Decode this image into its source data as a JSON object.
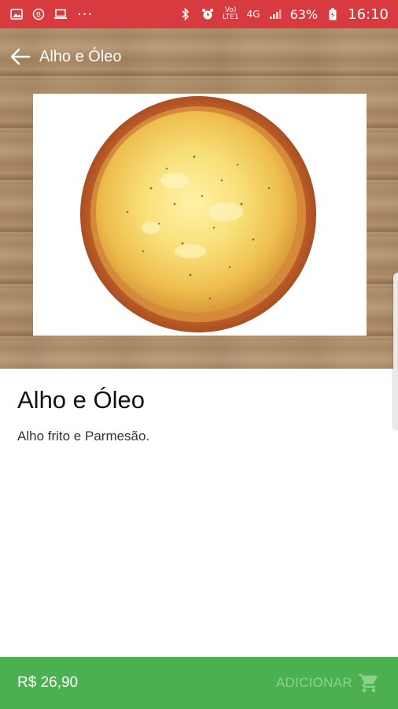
{
  "status_bar": {
    "left_icons": [
      "image-icon",
      "b-circle-icon",
      "laptop-icon"
    ],
    "more": "···",
    "network_top": "Vo)",
    "network_bottom": "LTE1",
    "net_type": "4G",
    "battery_percent": "63%",
    "time": "16:10"
  },
  "toolbar": {
    "title": "Alho e Óleo",
    "back_icon": "arrow-left-icon"
  },
  "product": {
    "name": "Alho e Óleo",
    "description": "Alho frito e Parmesão.",
    "image_icon": "pizza-image"
  },
  "bottom_bar": {
    "price": "R$ 26,90",
    "add_label": "ADICIONAR",
    "cart_icon": "shopping-cart-icon"
  },
  "colors": {
    "status_bar": "#d83b3f",
    "bottom_bar": "#4caf50",
    "add_label": "#8dd18f"
  }
}
